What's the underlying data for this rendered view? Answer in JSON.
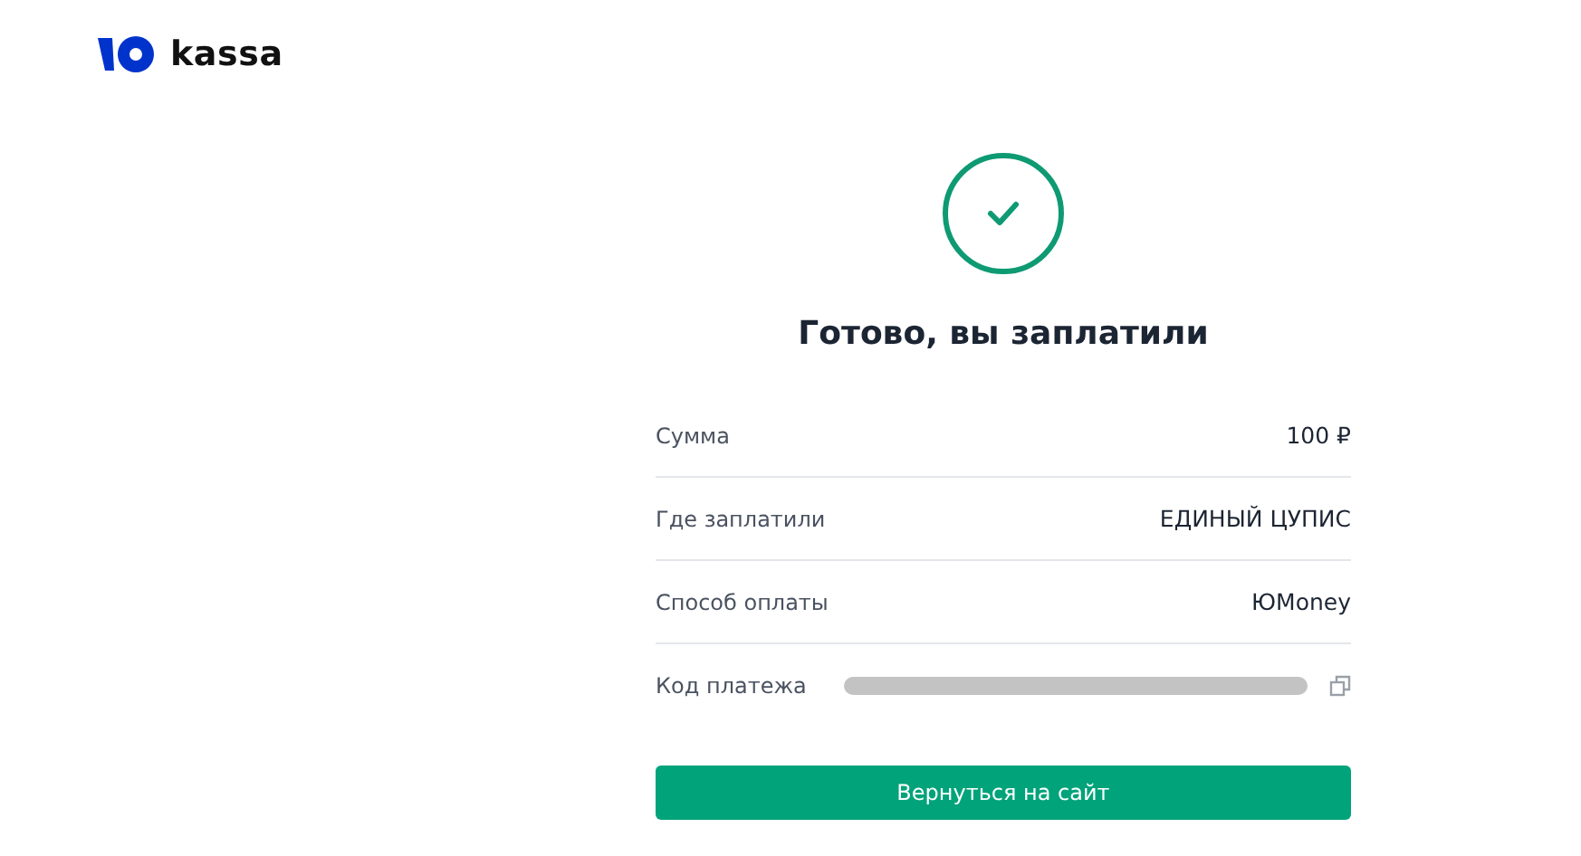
{
  "logo": {
    "text": "kassa"
  },
  "status": {
    "title": "Готово, вы заплатили"
  },
  "details": [
    {
      "kind": "text",
      "label": "Сумма",
      "value": "100 ₽"
    },
    {
      "kind": "text",
      "label": "Где заплатили",
      "value": "ЕДИНЫЙ ЦУПИС"
    },
    {
      "kind": "text",
      "label": "Способ оплаты",
      "value": "ЮMoney"
    },
    {
      "kind": "redacted",
      "label": "Код платежа"
    }
  ],
  "button": {
    "label": "Вернуться на сайт"
  }
}
